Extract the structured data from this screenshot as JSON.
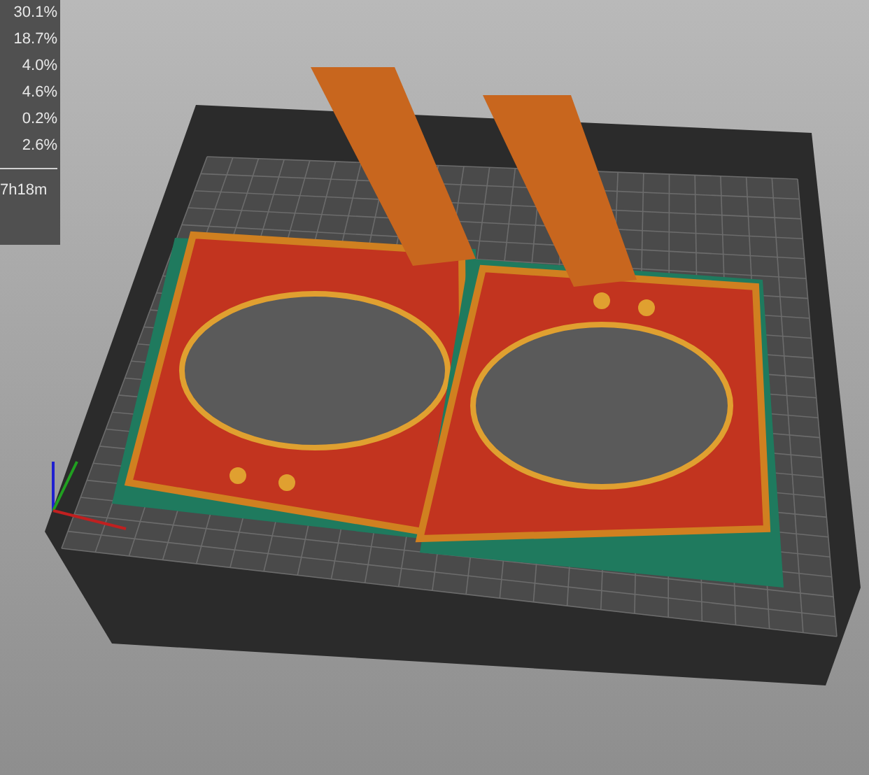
{
  "stats_panel": {
    "percentages": [
      "30.1%",
      "18.7%",
      "4.0%",
      "4.6%",
      "0.2%",
      "2.6%"
    ],
    "print_time": "7h18m"
  }
}
